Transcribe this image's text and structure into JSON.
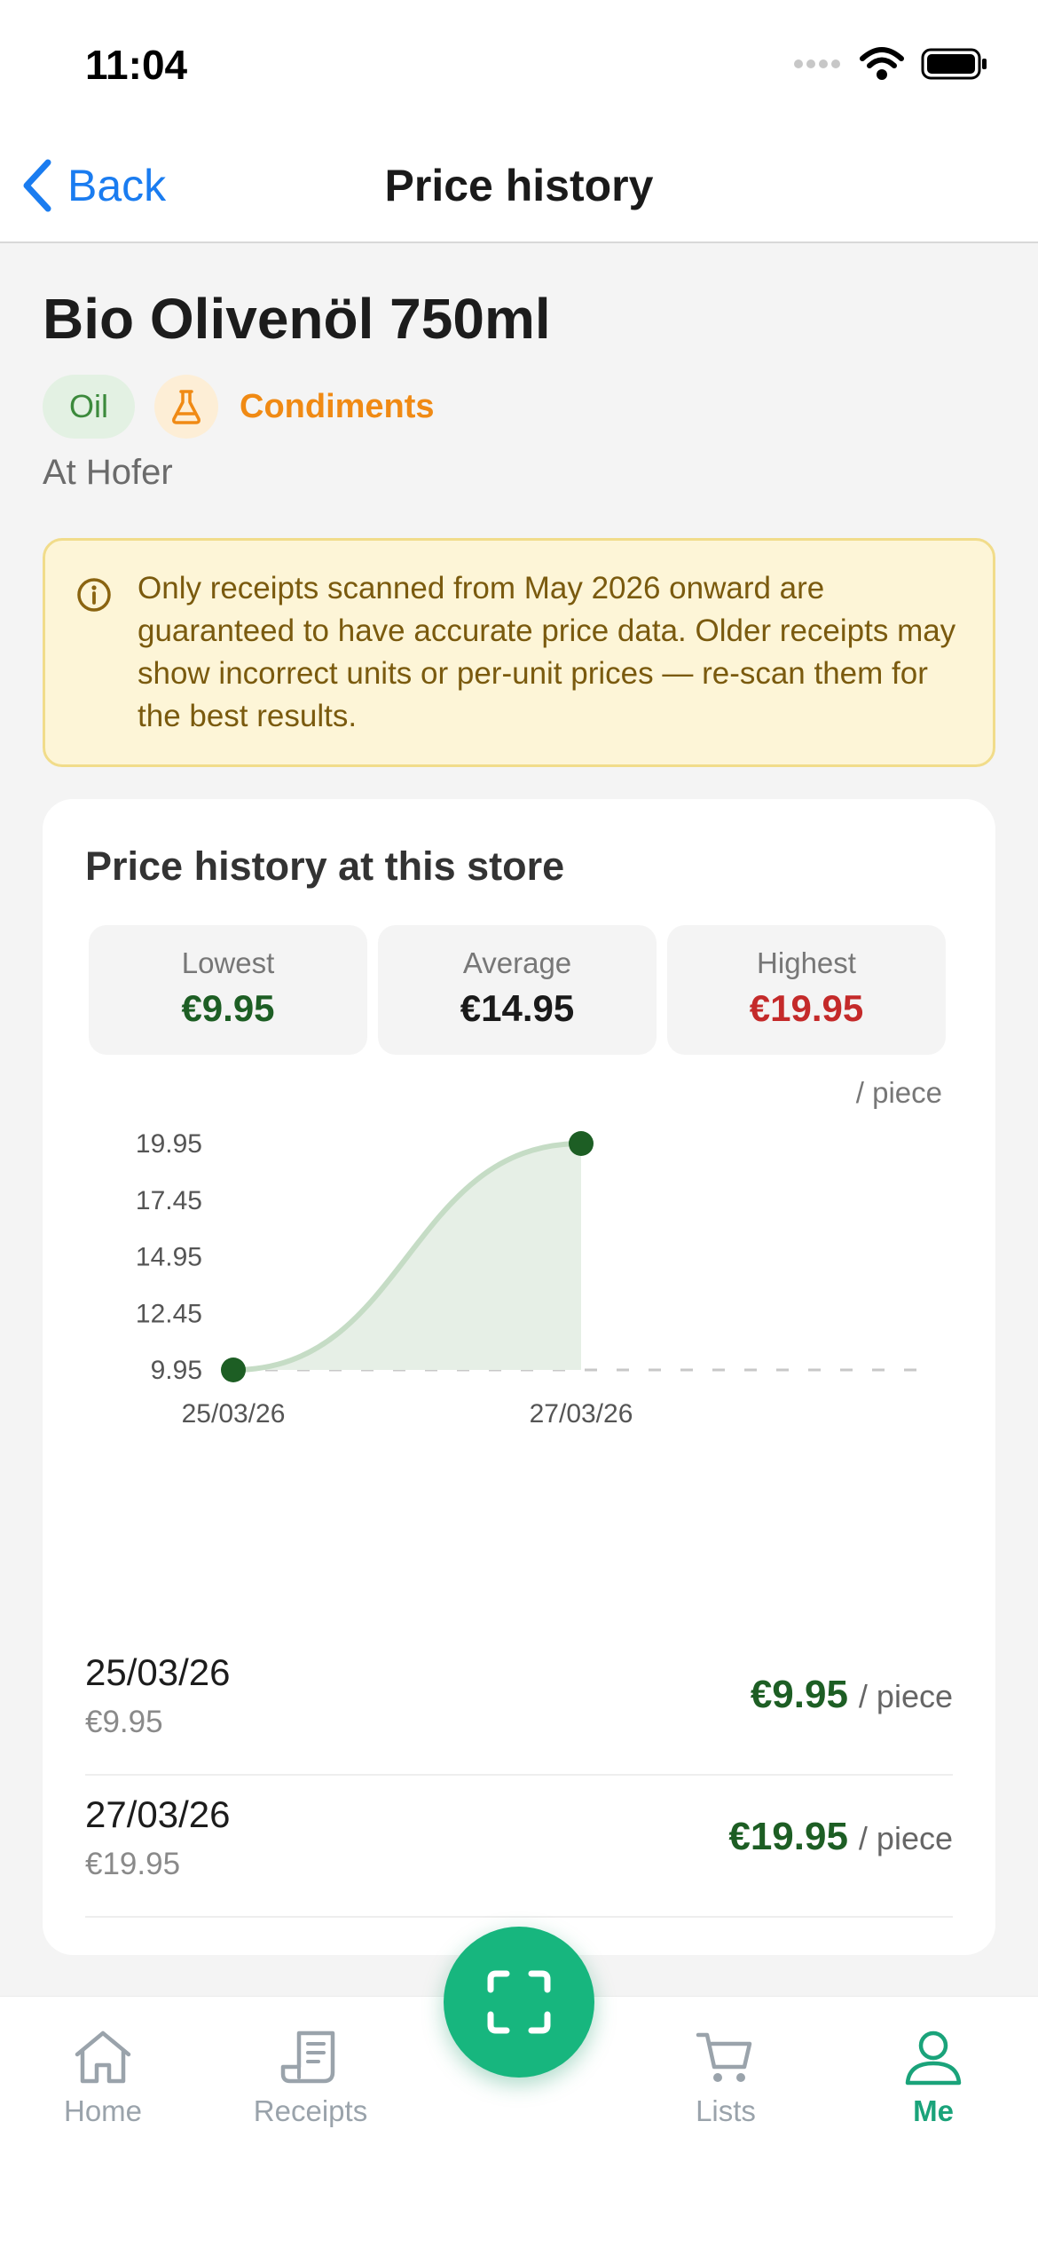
{
  "status_bar": {
    "time": "11:04"
  },
  "nav": {
    "back_label": "Back",
    "title": "Price history"
  },
  "product": {
    "name": "Bio Olivenöl 750ml",
    "tag_primary": "Oil",
    "category_icon": "flask-icon",
    "category": "Condiments",
    "store_line": "At Hofer"
  },
  "notice": {
    "icon": "info-icon",
    "text": "Only receipts scanned from May 2026 onward are guaranteed to have accurate price data. Older receipts may show incorrect units or per-unit prices — re-scan them for the best results."
  },
  "card": {
    "title": "Price history at this store",
    "stats": {
      "lowest_label": "Lowest",
      "lowest_value": "€9.95",
      "average_label": "Average",
      "average_value": "€14.95",
      "highest_label": "Highest",
      "highest_value": "€19.95"
    },
    "unit_note": "/ piece"
  },
  "chart_data": {
    "type": "area",
    "x": [
      "25/03/26",
      "27/03/26"
    ],
    "values": [
      9.95,
      19.95
    ],
    "ylim": [
      9.95,
      19.95
    ],
    "yticks": [
      "19.95",
      "17.45",
      "14.95",
      "12.45",
      "9.95"
    ],
    "reference_line": 9.95,
    "colors": {
      "line": "#c5dcc5",
      "fill": "#e6efe6",
      "point": "#1d5e24",
      "reference": "#c8c8c8"
    }
  },
  "history_rows": [
    {
      "date": "25/03/26",
      "sub": "€9.95",
      "price": "€9.95",
      "unit": "/ piece"
    },
    {
      "date": "27/03/26",
      "sub": "€19.95",
      "price": "€19.95",
      "unit": "/ piece"
    }
  ],
  "tabbar": {
    "home": "Home",
    "receipts": "Receipts",
    "lists": "Lists",
    "me": "Me",
    "active": "me"
  },
  "fab": {
    "icon": "scan-icon"
  }
}
